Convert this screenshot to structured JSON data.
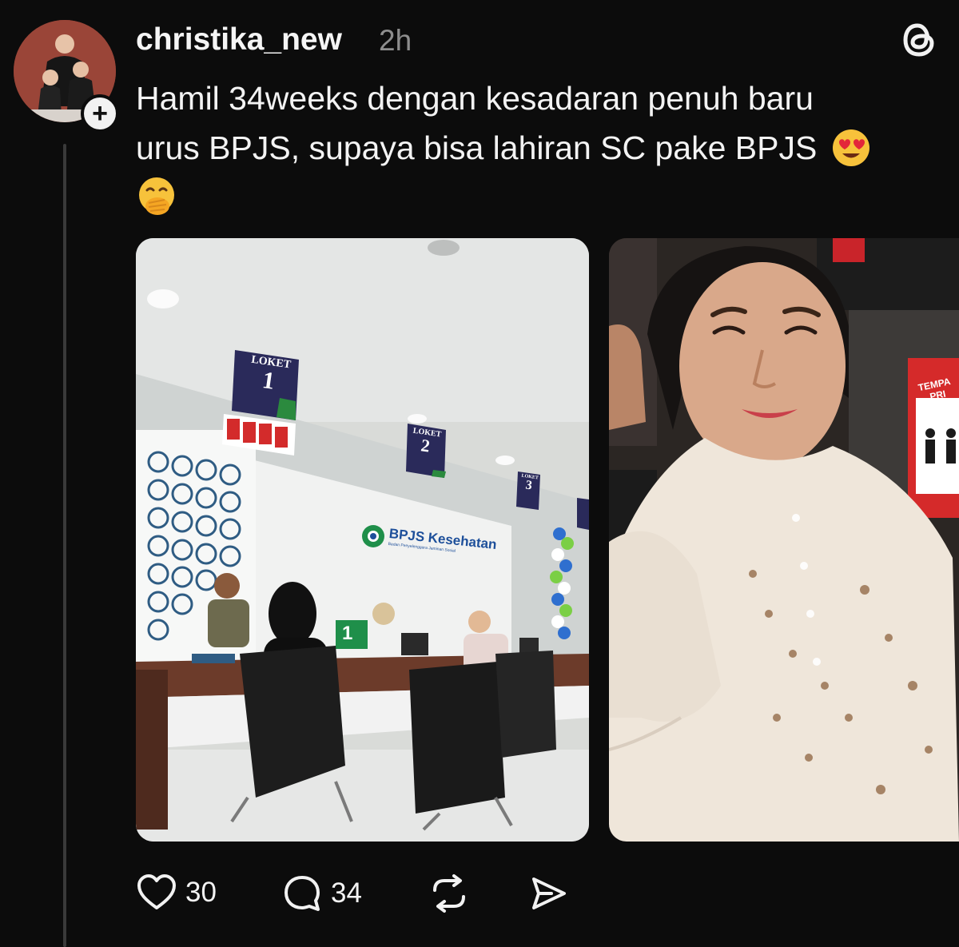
{
  "post": {
    "username": "christika_new",
    "time": "2h",
    "text_line1": "Hamil 34weeks dengan kesadaran penuh baru",
    "text_line2": "urus BPJS, supaya bisa lahiran SC pake BPJS",
    "emojis": [
      "heart-eyes-emoji",
      "hand-over-mouth-emoji"
    ]
  },
  "photo1": {
    "sign_loket": "LOKET",
    "loket_1": "1",
    "loket_2": "2",
    "loket_3": "3",
    "logo_text": "BPJS Kesehatan",
    "logo_subtext": "Badan Penyelenggara Jaminan Sosial",
    "desk_number": "1"
  },
  "photo2": {
    "sign_text_1": "TEMPA",
    "sign_text_2": "PRI"
  },
  "actions": {
    "likes": "30",
    "replies": "34"
  },
  "icons": {
    "logo": "threads-logo-icon",
    "like": "heart-icon",
    "reply": "comment-icon",
    "repost": "repost-icon",
    "share": "share-icon",
    "follow": "plus-icon"
  },
  "colors": {
    "background": "#0c0c0c",
    "text": "#f3f3f3",
    "muted": "#8e8e8e",
    "bpjs_green": "#1f8f4a",
    "bpjs_blue": "#1d4f9a"
  }
}
